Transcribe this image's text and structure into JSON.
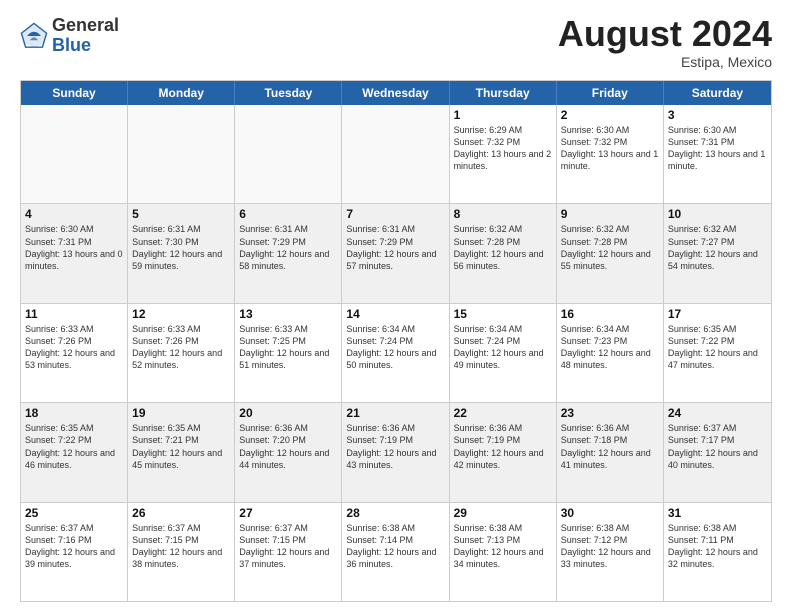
{
  "header": {
    "logo_general": "General",
    "logo_blue": "Blue",
    "month_year": "August 2024",
    "location": "Estipa, Mexico"
  },
  "days_of_week": [
    "Sunday",
    "Monday",
    "Tuesday",
    "Wednesday",
    "Thursday",
    "Friday",
    "Saturday"
  ],
  "weeks": [
    [
      {
        "day": "",
        "empty": true
      },
      {
        "day": "",
        "empty": true
      },
      {
        "day": "",
        "empty": true
      },
      {
        "day": "",
        "empty": true
      },
      {
        "day": "1",
        "sunrise": "6:29 AM",
        "sunset": "7:32 PM",
        "daylight": "13 hours and 2 minutes."
      },
      {
        "day": "2",
        "sunrise": "6:30 AM",
        "sunset": "7:32 PM",
        "daylight": "13 hours and 1 minute."
      },
      {
        "day": "3",
        "sunrise": "6:30 AM",
        "sunset": "7:31 PM",
        "daylight": "13 hours and 1 minute."
      }
    ],
    [
      {
        "day": "4",
        "sunrise": "6:30 AM",
        "sunset": "7:31 PM",
        "daylight": "13 hours and 0 minutes."
      },
      {
        "day": "5",
        "sunrise": "6:31 AM",
        "sunset": "7:30 PM",
        "daylight": "12 hours and 59 minutes."
      },
      {
        "day": "6",
        "sunrise": "6:31 AM",
        "sunset": "7:29 PM",
        "daylight": "12 hours and 58 minutes."
      },
      {
        "day": "7",
        "sunrise": "6:31 AM",
        "sunset": "7:29 PM",
        "daylight": "12 hours and 57 minutes."
      },
      {
        "day": "8",
        "sunrise": "6:32 AM",
        "sunset": "7:28 PM",
        "daylight": "12 hours and 56 minutes."
      },
      {
        "day": "9",
        "sunrise": "6:32 AM",
        "sunset": "7:28 PM",
        "daylight": "12 hours and 55 minutes."
      },
      {
        "day": "10",
        "sunrise": "6:32 AM",
        "sunset": "7:27 PM",
        "daylight": "12 hours and 54 minutes."
      }
    ],
    [
      {
        "day": "11",
        "sunrise": "6:33 AM",
        "sunset": "7:26 PM",
        "daylight": "12 hours and 53 minutes."
      },
      {
        "day": "12",
        "sunrise": "6:33 AM",
        "sunset": "7:26 PM",
        "daylight": "12 hours and 52 minutes."
      },
      {
        "day": "13",
        "sunrise": "6:33 AM",
        "sunset": "7:25 PM",
        "daylight": "12 hours and 51 minutes."
      },
      {
        "day": "14",
        "sunrise": "6:34 AM",
        "sunset": "7:24 PM",
        "daylight": "12 hours and 50 minutes."
      },
      {
        "day": "15",
        "sunrise": "6:34 AM",
        "sunset": "7:24 PM",
        "daylight": "12 hours and 49 minutes."
      },
      {
        "day": "16",
        "sunrise": "6:34 AM",
        "sunset": "7:23 PM",
        "daylight": "12 hours and 48 minutes."
      },
      {
        "day": "17",
        "sunrise": "6:35 AM",
        "sunset": "7:22 PM",
        "daylight": "12 hours and 47 minutes."
      }
    ],
    [
      {
        "day": "18",
        "sunrise": "6:35 AM",
        "sunset": "7:22 PM",
        "daylight": "12 hours and 46 minutes."
      },
      {
        "day": "19",
        "sunrise": "6:35 AM",
        "sunset": "7:21 PM",
        "daylight": "12 hours and 45 minutes."
      },
      {
        "day": "20",
        "sunrise": "6:36 AM",
        "sunset": "7:20 PM",
        "daylight": "12 hours and 44 minutes."
      },
      {
        "day": "21",
        "sunrise": "6:36 AM",
        "sunset": "7:19 PM",
        "daylight": "12 hours and 43 minutes."
      },
      {
        "day": "22",
        "sunrise": "6:36 AM",
        "sunset": "7:19 PM",
        "daylight": "12 hours and 42 minutes."
      },
      {
        "day": "23",
        "sunrise": "6:36 AM",
        "sunset": "7:18 PM",
        "daylight": "12 hours and 41 minutes."
      },
      {
        "day": "24",
        "sunrise": "6:37 AM",
        "sunset": "7:17 PM",
        "daylight": "12 hours and 40 minutes."
      }
    ],
    [
      {
        "day": "25",
        "sunrise": "6:37 AM",
        "sunset": "7:16 PM",
        "daylight": "12 hours and 39 minutes."
      },
      {
        "day": "26",
        "sunrise": "6:37 AM",
        "sunset": "7:15 PM",
        "daylight": "12 hours and 38 minutes."
      },
      {
        "day": "27",
        "sunrise": "6:37 AM",
        "sunset": "7:15 PM",
        "daylight": "12 hours and 37 minutes."
      },
      {
        "day": "28",
        "sunrise": "6:38 AM",
        "sunset": "7:14 PM",
        "daylight": "12 hours and 36 minutes."
      },
      {
        "day": "29",
        "sunrise": "6:38 AM",
        "sunset": "7:13 PM",
        "daylight": "12 hours and 34 minutes."
      },
      {
        "day": "30",
        "sunrise": "6:38 AM",
        "sunset": "7:12 PM",
        "daylight": "12 hours and 33 minutes."
      },
      {
        "day": "31",
        "sunrise": "6:38 AM",
        "sunset": "7:11 PM",
        "daylight": "12 hours and 32 minutes."
      }
    ]
  ]
}
